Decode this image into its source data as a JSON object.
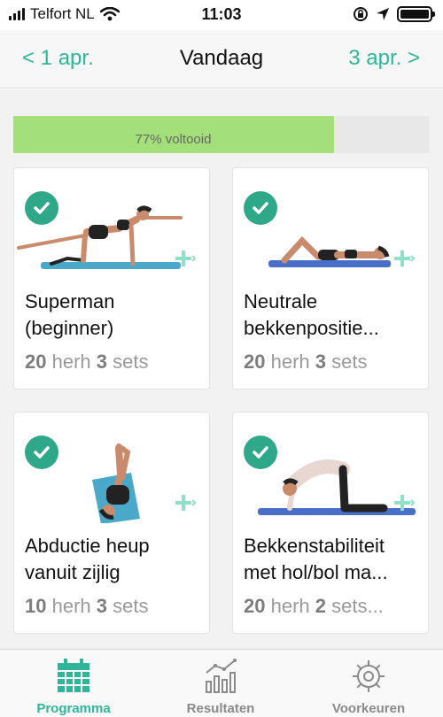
{
  "status_bar": {
    "carrier": "Telfort NL",
    "time": "11:03",
    "battery_level": 1.0
  },
  "header": {
    "prev_label": "< 1 apr.",
    "title": "Vandaag",
    "next_label": "3 apr. >"
  },
  "progress": {
    "percent": 77,
    "label": "77% voltooid"
  },
  "exercises": [
    {
      "name": "Superman\n(beginner)",
      "reps": "20",
      "reps_unit": " herh ",
      "sets": "3",
      "sets_unit": " sets",
      "completed": true
    },
    {
      "name": "Neutrale\nbekkenpositie...",
      "reps": "20",
      "reps_unit": " herh ",
      "sets": "3",
      "sets_unit": " sets",
      "completed": true
    },
    {
      "name": "Abductie heup\nvanuit zijlig",
      "reps": "10",
      "reps_unit": " herh ",
      "sets": "3",
      "sets_unit": " sets",
      "completed": true
    },
    {
      "name": "Bekkenstabiliteit\nmet hol/bol ma...",
      "reps": "20",
      "reps_unit": " herh ",
      "sets": "2",
      "sets_unit": " sets...",
      "completed": true
    }
  ],
  "tabs": [
    {
      "label": "Programma",
      "icon": "calendar-icon",
      "active": true
    },
    {
      "label": "Resultaten",
      "icon": "chart-icon",
      "active": false
    },
    {
      "label": "Voorkeuren",
      "icon": "gear-icon",
      "active": false
    }
  ],
  "colors": {
    "accent": "#2fb59a",
    "check": "#2fa88a",
    "progress_fill": "#a4e07a",
    "mat": "#4aa8c9"
  }
}
